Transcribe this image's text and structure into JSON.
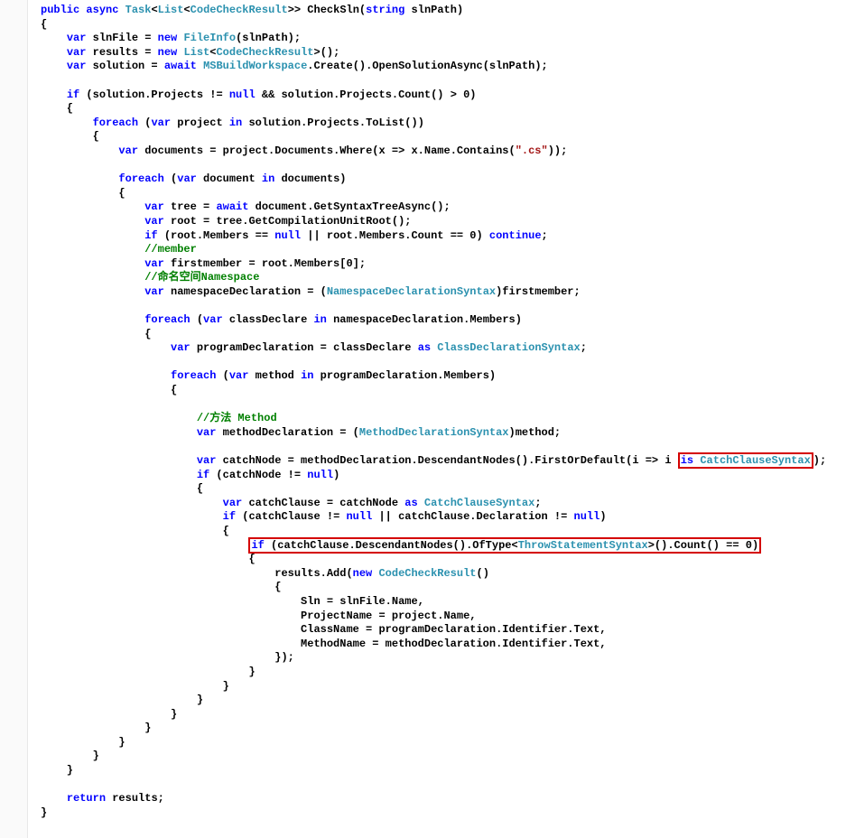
{
  "code": {
    "l1": "public async Task<List<CodeCheckResult>> CheckSln(string slnPath)",
    "l2": "{",
    "l3": "    var slnFile = new FileInfo(slnPath);",
    "l4": "    var results = new List<CodeCheckResult>();",
    "l5": "    var solution = await MSBuildWorkspace.Create().OpenSolutionAsync(slnPath);",
    "l6": "",
    "l7": "    if (solution.Projects != null && solution.Projects.Count() > 0)",
    "l8": "    {",
    "l9": "        foreach (var project in solution.Projects.ToList())",
    "l10": "        {",
    "l11": "            var documents = project.Documents.Where(x => x.Name.Contains(\".cs\"));",
    "l12": "",
    "l13": "            foreach (var document in documents)",
    "l14": "            {",
    "l15": "                var tree = await document.GetSyntaxTreeAsync();",
    "l16": "                var root = tree.GetCompilationUnitRoot();",
    "l17": "                if (root.Members == null || root.Members.Count == 0) continue;",
    "l18": "                //member",
    "l19": "                var firstmember = root.Members[0];",
    "l20": "                //命名空间Namespace",
    "l21": "                var namespaceDeclaration = (NamespaceDeclarationSyntax)firstmember;",
    "l22": "",
    "l23": "                foreach (var classDeclare in namespaceDeclaration.Members)",
    "l24": "                {",
    "l25": "                    var programDeclaration = classDeclare as ClassDeclarationSyntax;",
    "l26": "",
    "l27": "                    foreach (var method in programDeclaration.Members)",
    "l28": "                    {",
    "l29": "",
    "l30": "                        //方法 Method",
    "l31": "                        var methodDeclaration = (MethodDeclarationSyntax)method;",
    "l32": "",
    "l33_a": "                        var catchNode = methodDeclaration.DescendantNodes().FirstOrDefault(i => i ",
    "l33_b": "is CatchClauseSyntax",
    "l33_c": ");",
    "l34": "                        if (catchNode != null)",
    "l35": "                        {",
    "l36": "                            var catchClause = catchNode as CatchClauseSyntax;",
    "l37": "                            if (catchClause != null || catchClause.Declaration != null)",
    "l38": "                            {",
    "l39_a": "                                if (catchClause.DescendantNodes().OfType<ThrowStatementSyntax>().Count() == 0)",
    "l40": "                                {",
    "l41": "                                    results.Add(new CodeCheckResult()",
    "l42": "                                    {",
    "l43": "                                        Sln = slnFile.Name,",
    "l44": "                                        ProjectName = project.Name,",
    "l45": "                                        ClassName = programDeclaration.Identifier.Text,",
    "l46": "                                        MethodName = methodDeclaration.Identifier.Text,",
    "l47": "                                    });",
    "l48": "                                }",
    "l49": "                            }",
    "l50": "                        }",
    "l51": "                    }",
    "l52": "                }",
    "l53": "            }",
    "l54": "        }",
    "l55": "    }",
    "l56": "",
    "l57": "    return results;",
    "l58": "}",
    "l59": "}"
  }
}
